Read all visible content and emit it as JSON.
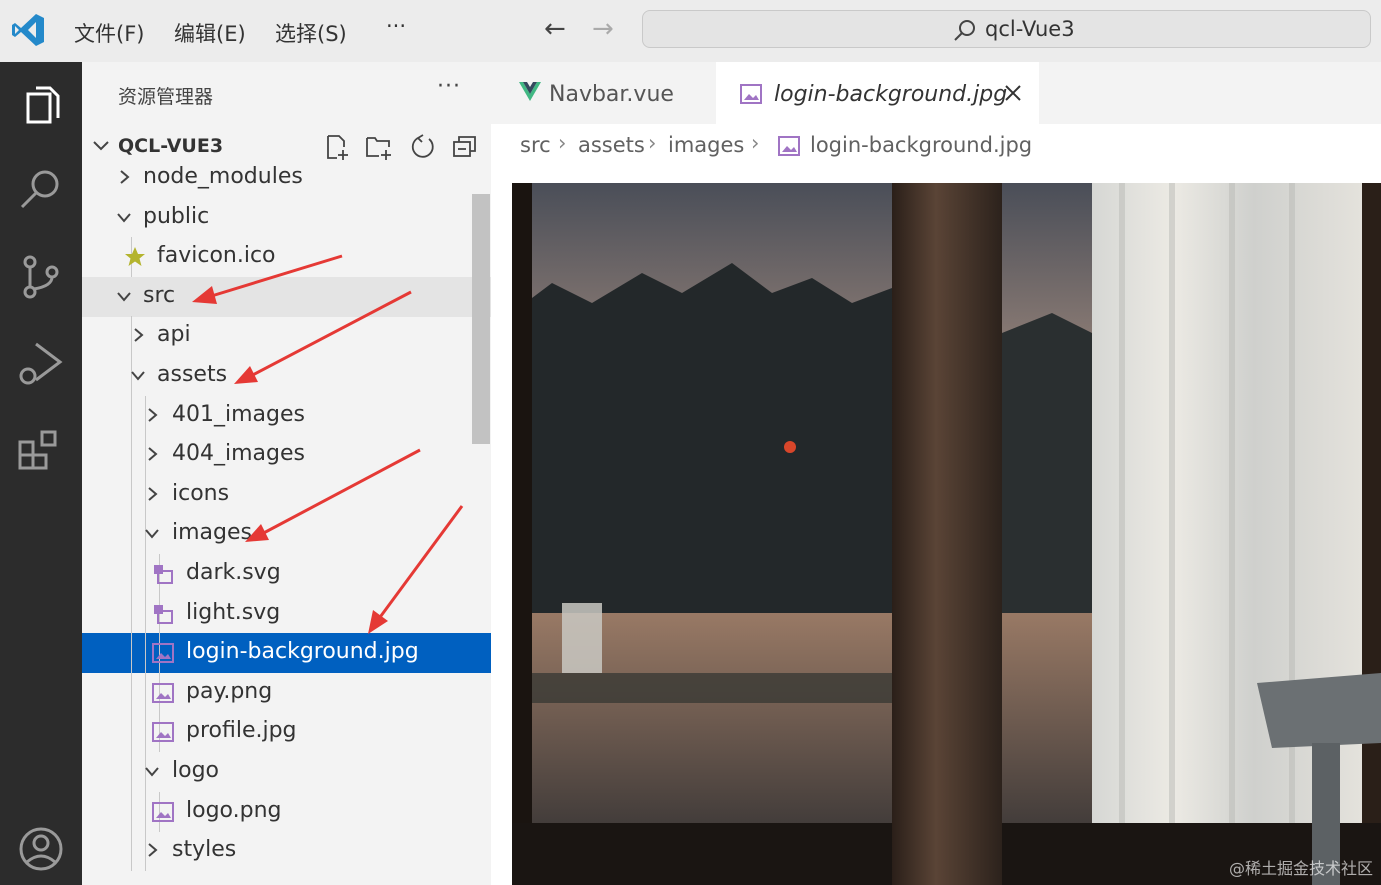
{
  "titlebar": {
    "menus": [
      "文件(F)",
      "编辑(E)",
      "选择(S)",
      "···"
    ],
    "search_text": "qcl-Vue3"
  },
  "activity": [
    "explorer-icon",
    "search-icon",
    "source-control-icon",
    "run-debug-icon",
    "extensions-icon",
    "account-icon"
  ],
  "sidebar": {
    "title": "资源管理器",
    "more": "···",
    "project": "QCL-VUE3",
    "tree": [
      {
        "label": "node_modules",
        "icon": "none",
        "chevron": "right",
        "depth": 0
      },
      {
        "label": "public",
        "icon": "none",
        "chevron": "down",
        "depth": 0
      },
      {
        "label": "favicon.ico",
        "icon": "star",
        "chevron": "none",
        "depth": 1
      },
      {
        "label": "src",
        "icon": "none",
        "chevron": "down",
        "depth": 0
      },
      {
        "label": "api",
        "icon": "none",
        "chevron": "right",
        "depth": 1
      },
      {
        "label": "assets",
        "icon": "none",
        "chevron": "down",
        "depth": 1
      },
      {
        "label": "401_images",
        "icon": "none",
        "chevron": "right",
        "depth": 2
      },
      {
        "label": "404_images",
        "icon": "none",
        "chevron": "right",
        "depth": 2
      },
      {
        "label": "icons",
        "icon": "none",
        "chevron": "right",
        "depth": 2
      },
      {
        "label": "images",
        "icon": "none",
        "chevron": "down",
        "depth": 2
      },
      {
        "label": "dark.svg",
        "icon": "svg",
        "chevron": "none",
        "depth": 3
      },
      {
        "label": "light.svg",
        "icon": "svg",
        "chevron": "none",
        "depth": 3
      },
      {
        "label": "login-background.jpg",
        "icon": "image",
        "chevron": "none",
        "depth": 3
      },
      {
        "label": "pay.png",
        "icon": "image",
        "chevron": "none",
        "depth": 3
      },
      {
        "label": "profile.jpg",
        "icon": "image",
        "chevron": "none",
        "depth": 3
      },
      {
        "label": "logo",
        "icon": "none",
        "chevron": "down",
        "depth": 2
      },
      {
        "label": "logo.png",
        "icon": "image",
        "chevron": "none",
        "depth": 3
      },
      {
        "label": "styles",
        "icon": "none",
        "chevron": "right",
        "depth": 2
      }
    ]
  },
  "tabs": [
    {
      "label": "Navbar.vue",
      "icon": "vue-icon",
      "active": false
    },
    {
      "label": "login-background.jpg",
      "icon": "image-icon",
      "active": true
    }
  ],
  "breadcrumb": [
    "src",
    "assets",
    "images",
    "login-background.jpg"
  ],
  "watermark": "@稀土掘金技术社区",
  "colors": {
    "selection": "#0060c0",
    "activitybar": "#2c2c2c",
    "vue_green": "#41b883",
    "image_icon": "#a074c4",
    "arrow": "#e53935"
  }
}
